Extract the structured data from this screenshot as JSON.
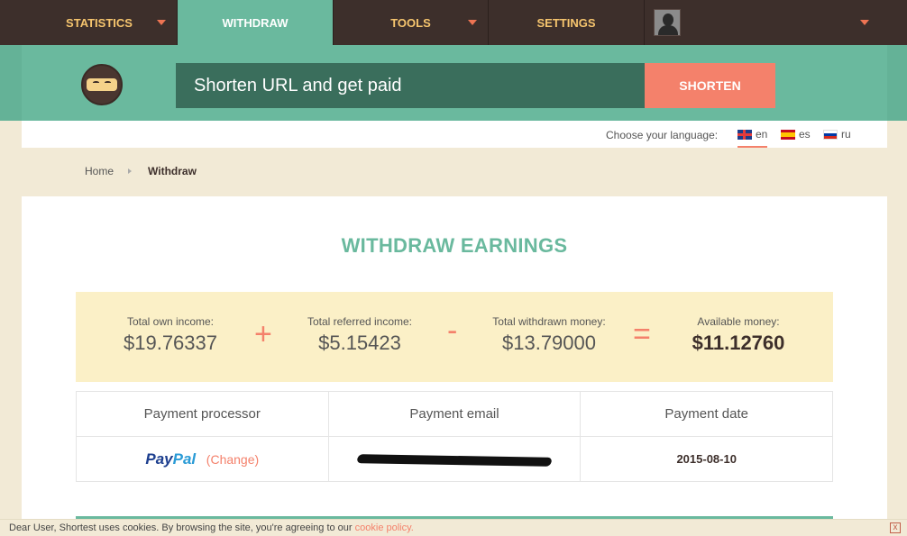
{
  "nav": {
    "items": [
      {
        "label": "STATISTICS"
      },
      {
        "label": "WITHDRAW"
      },
      {
        "label": "TOOLS"
      },
      {
        "label": "SETTINGS"
      }
    ]
  },
  "shortener": {
    "placeholder": "Shorten URL and get paid",
    "button_label": "SHORTEN"
  },
  "language": {
    "label": "Choose your language:",
    "options": [
      {
        "code": "en",
        "flag": "uk-flag-icon"
      },
      {
        "code": "es",
        "flag": "spain-flag-icon"
      },
      {
        "code": "ru",
        "flag": "russia-flag-icon"
      }
    ],
    "selected": "en"
  },
  "breadcrumb": {
    "home": "Home",
    "current": "Withdraw"
  },
  "page": {
    "title": "WITHDRAW EARNINGS"
  },
  "summary": {
    "own": {
      "label": "Total own income:",
      "value": "$19.76337"
    },
    "op1": "+",
    "referred": {
      "label": "Total referred income:",
      "value": "$5.15423"
    },
    "op2": "-",
    "withdrawn": {
      "label": "Total withdrawn money:",
      "value": "$13.79000"
    },
    "op3": "=",
    "available": {
      "label": "Available money:",
      "value": "$11.12760"
    }
  },
  "payment_table": {
    "headers": [
      "Payment processor",
      "Payment email",
      "Payment date"
    ],
    "row": {
      "processor_part1": "Pay",
      "processor_part2": "Pal",
      "change_label": "(Change)",
      "date": "2015-08-10"
    }
  },
  "cookie_bar": {
    "text": "Dear User, Shortest uses cookies. By browsing the site, you're agreeing to our",
    "link": "cookie policy.",
    "close": "x"
  },
  "colors": {
    "nav_bg": "#3d2f2b",
    "accent_green": "#6ab99e",
    "accent_coral": "#f4816b",
    "nav_text": "#f6c56e",
    "summary_bg": "#fbf0c7",
    "page_bg": "#f2ead6"
  }
}
